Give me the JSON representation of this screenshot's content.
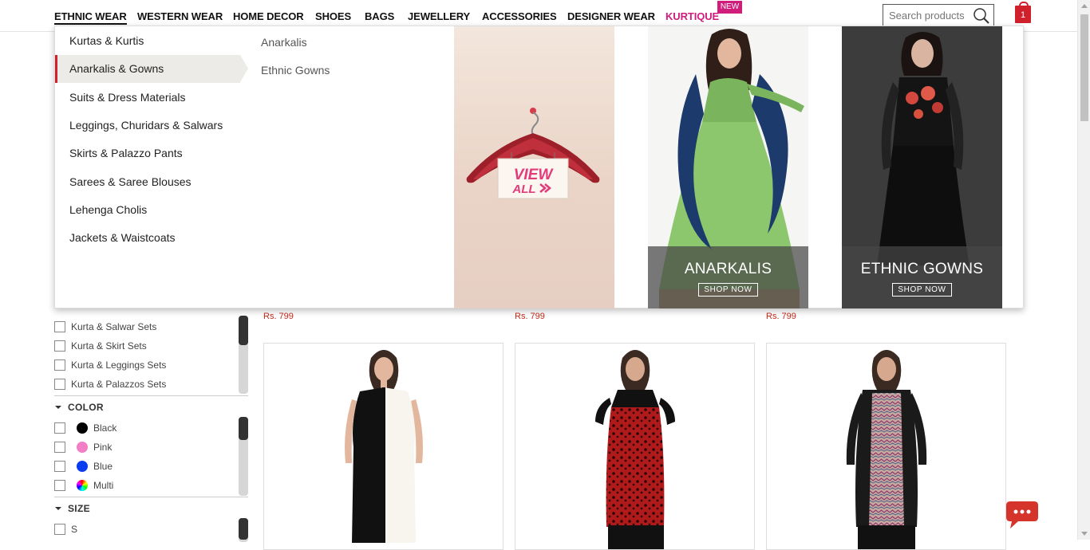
{
  "nav": {
    "items": [
      "ETHNIC WEAR",
      "WESTERN WEAR",
      "HOME DECOR",
      "SHOES",
      "BAGS",
      "JEWELLERY",
      "ACCESSORIES",
      "DESIGNER WEAR",
      "KURTIQUE"
    ],
    "new_badge": "NEW",
    "search_placeholder": "Search products",
    "cart_count": "1"
  },
  "mega_menu": {
    "categories": [
      "Kurtas & Kurtis",
      "Anarkalis & Gowns",
      "Suits & Dress Materials",
      "Leggings, Churidars & Salwars",
      "Skirts & Palazzo Pants",
      "Sarees & Saree Blouses",
      "Lehenga Cholis",
      "Jackets & Waistcoats"
    ],
    "selected_index": 1,
    "subcategories": [
      "Anarkalis",
      "Ethnic Gowns"
    ],
    "view_all_line1": "VIEW",
    "view_all_line2": "ALL",
    "promos": [
      {
        "title": "ANARKALIS",
        "button": "SHOP NOW"
      },
      {
        "title": "ETHNIC GOWNS",
        "button": "SHOP NOW"
      }
    ]
  },
  "filters": {
    "sets": [
      "Kurta & Salwar Sets",
      "Kurta & Skirt Sets",
      "Kurta & Leggings Sets",
      "Kurta & Palazzos Sets"
    ],
    "color_title": "COLOR",
    "colors": [
      {
        "name": "Black",
        "hex": "#000000"
      },
      {
        "name": "Pink",
        "hex": "#f27fc6"
      },
      {
        "name": "Blue",
        "hex": "#0a3cf0"
      },
      {
        "name": "Multi",
        "hex": "multi"
      }
    ],
    "size_title": "SIZE",
    "sizes": [
      "S"
    ]
  },
  "products": {
    "prices": [
      "Rs. 799",
      "Rs. 799",
      "Rs. 799"
    ]
  },
  "colors": {
    "accent": "#d0202c",
    "kurtique": "#d01c7b",
    "price": "#c62a1a"
  }
}
